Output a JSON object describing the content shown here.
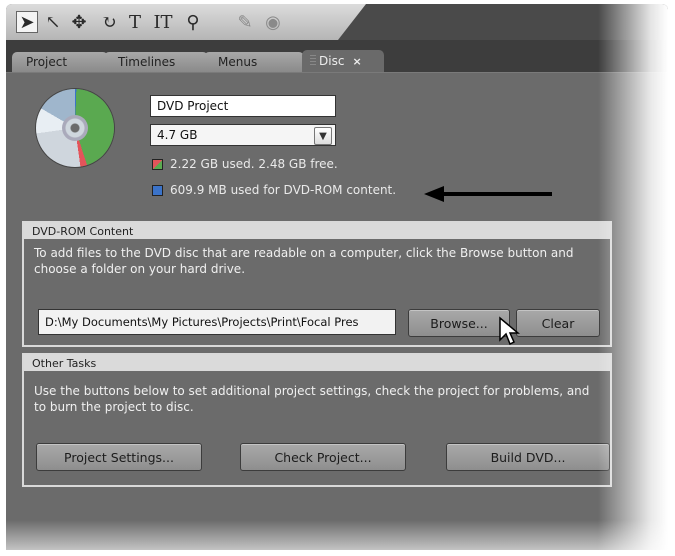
{
  "toolbar": {
    "tools": [
      {
        "icon": "selection-arrow-icon",
        "glyph": "➤"
      },
      {
        "icon": "direct-select-icon",
        "glyph": "↖"
      },
      {
        "icon": "move-icon",
        "glyph": "✥"
      },
      {
        "icon": "rotate-icon",
        "glyph": "↻"
      },
      {
        "icon": "text-icon",
        "glyph": "T"
      },
      {
        "icon": "vertical-text-icon",
        "glyph": "IT"
      },
      {
        "icon": "zoom-icon",
        "glyph": "⚲"
      },
      {
        "icon": "edit-icon",
        "glyph": "✎"
      },
      {
        "icon": "preview-icon",
        "glyph": "◉"
      }
    ]
  },
  "tabs": [
    {
      "label": "Project"
    },
    {
      "label": "Timelines"
    },
    {
      "label": "Menus"
    },
    {
      "label": "Disc",
      "close": "×"
    }
  ],
  "disc": {
    "name_value": "DVD Project",
    "size_value": "4.7 GB",
    "used_text": "2.22 GB used.  2.48 GB free.",
    "dvdrom_text": "609.9 MB used for DVD-ROM content.",
    "colors": {
      "used": "#5aa950",
      "free": "#e3545a",
      "dvdrom": "#3b73c9"
    }
  },
  "dvdrom_group": {
    "title": "DVD-ROM Content",
    "description": "To add files to the DVD disc that are readable on a computer, click the Browse button and choose a folder on your hard drive.",
    "path_value": "D:\\My Documents\\My Pictures\\Projects\\Print\\Focal Pres",
    "browse_label": "Browse...",
    "clear_label": "Clear"
  },
  "tasks_group": {
    "title": "Other Tasks",
    "description": "Use the buttons below to set additional project settings, check the project for problems, and to burn the project to disc.",
    "project_settings_label": "Project Settings...",
    "check_project_label": "Check Project...",
    "build_dvd_label": "Build DVD..."
  }
}
